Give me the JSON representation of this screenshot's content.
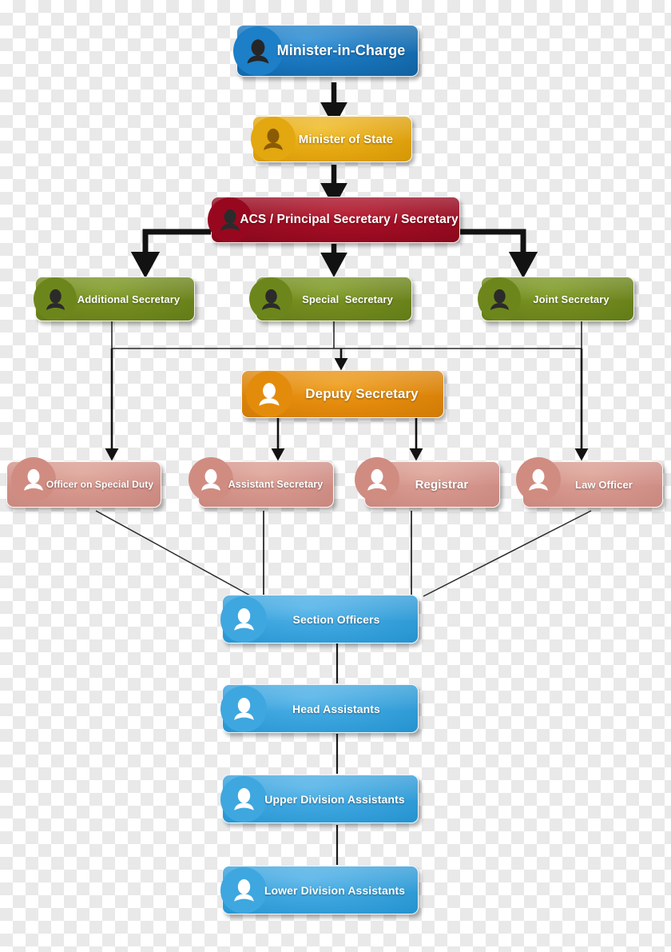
{
  "diagram": {
    "title": "Government Department Organizational Hierarchy Chart",
    "type": "organizational-chart",
    "background": "transparent-checkerboard",
    "palette": {
      "blue_dark": "#1a77bf",
      "amber": "#e6a913",
      "crimson": "#9c0c22",
      "olive_green": "#70881d",
      "orange": "#e2890c",
      "salmon": "#d3938a",
      "blue_light": "#3aa3dd",
      "connector": "#1a1a1a",
      "label_text": "#ffffff"
    },
    "levels": [
      {
        "level": 1,
        "name": "minister-in-charge-level",
        "nodes": [
          {
            "id": "minister-in-charge",
            "label": "Minister-in-Charge",
            "color": "#1a77bf",
            "color_name": "blue_dark",
            "icon": "person-icon",
            "icon_style": "dark-silhouette"
          }
        ]
      },
      {
        "level": 2,
        "name": "minister-of-state-level",
        "nodes": [
          {
            "id": "minister-of-state",
            "label": "Minister of State",
            "color": "#e6a913",
            "color_name": "amber",
            "icon": "person-icon",
            "icon_style": "dark-silhouette"
          }
        ]
      },
      {
        "level": 3,
        "name": "secretary-level",
        "nodes": [
          {
            "id": "acs-principal-secretary",
            "label": "ACS / Principal Secretary / Secretary",
            "color": "#9c0c22",
            "color_name": "crimson",
            "icon": "person-icon",
            "icon_style": "dark-silhouette"
          }
        ]
      },
      {
        "level": 4,
        "name": "secretaries-row",
        "nodes": [
          {
            "id": "additional-secretary",
            "label": "Additional Secretary",
            "color": "#70881d",
            "color_name": "olive_green",
            "icon": "person-icon",
            "icon_style": "dark-silhouette"
          },
          {
            "id": "special-secretary",
            "label": "Special  Secretary",
            "color": "#70881d",
            "color_name": "olive_green",
            "icon": "person-icon",
            "icon_style": "dark-silhouette"
          },
          {
            "id": "joint-secretary",
            "label": "Joint Secretary",
            "color": "#70881d",
            "color_name": "olive_green",
            "icon": "person-icon",
            "icon_style": "dark-silhouette"
          }
        ]
      },
      {
        "level": 5,
        "name": "deputy-secretary-level",
        "nodes": [
          {
            "id": "deputy-secretary",
            "label": "Deputy Secretary",
            "color": "#e2890c",
            "color_name": "orange",
            "icon": "person-icon",
            "icon_style": "white-silhouette"
          }
        ]
      },
      {
        "level": 6,
        "name": "officers-row",
        "nodes": [
          {
            "id": "officer-on-special-duty",
            "label": "Officer on Special Duty",
            "color": "#d3938a",
            "color_name": "salmon",
            "icon": "person-icon",
            "icon_style": "white-silhouette"
          },
          {
            "id": "assistant-secretary",
            "label": "Assistant Secretary",
            "color": "#d3938a",
            "color_name": "salmon",
            "icon": "person-icon",
            "icon_style": "white-silhouette"
          },
          {
            "id": "registrar",
            "label": "Registrar",
            "color": "#d3938a",
            "color_name": "salmon",
            "icon": "person-icon",
            "icon_style": "white-silhouette"
          },
          {
            "id": "law-officer",
            "label": "Law Officer",
            "color": "#d3938a",
            "color_name": "salmon",
            "icon": "person-icon",
            "icon_style": "white-silhouette"
          }
        ]
      },
      {
        "level": 7,
        "name": "section-officers-level",
        "nodes": [
          {
            "id": "section-officers",
            "label": "Section Officers",
            "color": "#3aa3dd",
            "color_name": "blue_light",
            "icon": "person-icon",
            "icon_style": "white-silhouette"
          }
        ]
      },
      {
        "level": 8,
        "name": "head-assistants-level",
        "nodes": [
          {
            "id": "head-assistants",
            "label": "Head Assistants",
            "color": "#3aa3dd",
            "color_name": "blue_light",
            "icon": "person-icon",
            "icon_style": "white-silhouette"
          }
        ]
      },
      {
        "level": 9,
        "name": "upper-division-assistants-level",
        "nodes": [
          {
            "id": "upper-division-assistants",
            "label": "Upper Division Assistants",
            "color": "#3aa3dd",
            "color_name": "blue_light",
            "icon": "person-icon",
            "icon_style": "white-silhouette"
          }
        ]
      },
      {
        "level": 10,
        "name": "lower-division-assistants-level",
        "nodes": [
          {
            "id": "lower-division-assistants",
            "label": "Lower Division Assistants",
            "color": "#3aa3dd",
            "color_name": "blue_light",
            "icon": "person-icon",
            "icon_style": "white-silhouette"
          }
        ]
      }
    ],
    "connections": [
      {
        "from": "minister-in-charge",
        "to": "minister-of-state",
        "style": "thick-arrow"
      },
      {
        "from": "minister-of-state",
        "to": "acs-principal-secretary",
        "style": "thick-arrow"
      },
      {
        "from": "acs-principal-secretary",
        "to": "additional-secretary",
        "style": "thick-elbow-arrow"
      },
      {
        "from": "acs-principal-secretary",
        "to": "special-secretary",
        "style": "thick-arrow"
      },
      {
        "from": "acs-principal-secretary",
        "to": "joint-secretary",
        "style": "thick-elbow-arrow"
      },
      {
        "from": "secretaries-row",
        "to": "deputy-secretary",
        "style": "thin-bus-arrow"
      },
      {
        "from": "secretaries-row",
        "to": "officer-on-special-duty",
        "style": "thin-bus-arrow"
      },
      {
        "from": "secretaries-row",
        "to": "law-officer",
        "style": "thin-bus-arrow"
      },
      {
        "from": "deputy-secretary",
        "to": "assistant-secretary",
        "style": "thin-arrow"
      },
      {
        "from": "deputy-secretary",
        "to": "registrar",
        "style": "thin-arrow"
      },
      {
        "from": "officer-on-special-duty",
        "to": "section-officers",
        "style": "thin-diagonal"
      },
      {
        "from": "assistant-secretary",
        "to": "section-officers",
        "style": "thin-line"
      },
      {
        "from": "registrar",
        "to": "section-officers",
        "style": "thin-line"
      },
      {
        "from": "law-officer",
        "to": "section-officers",
        "style": "thin-diagonal"
      },
      {
        "from": "section-officers",
        "to": "head-assistants",
        "style": "thin-line"
      },
      {
        "from": "head-assistants",
        "to": "upper-division-assistants",
        "style": "thin-line"
      },
      {
        "from": "upper-division-assistants",
        "to": "lower-division-assistants",
        "style": "thin-line"
      }
    ]
  }
}
